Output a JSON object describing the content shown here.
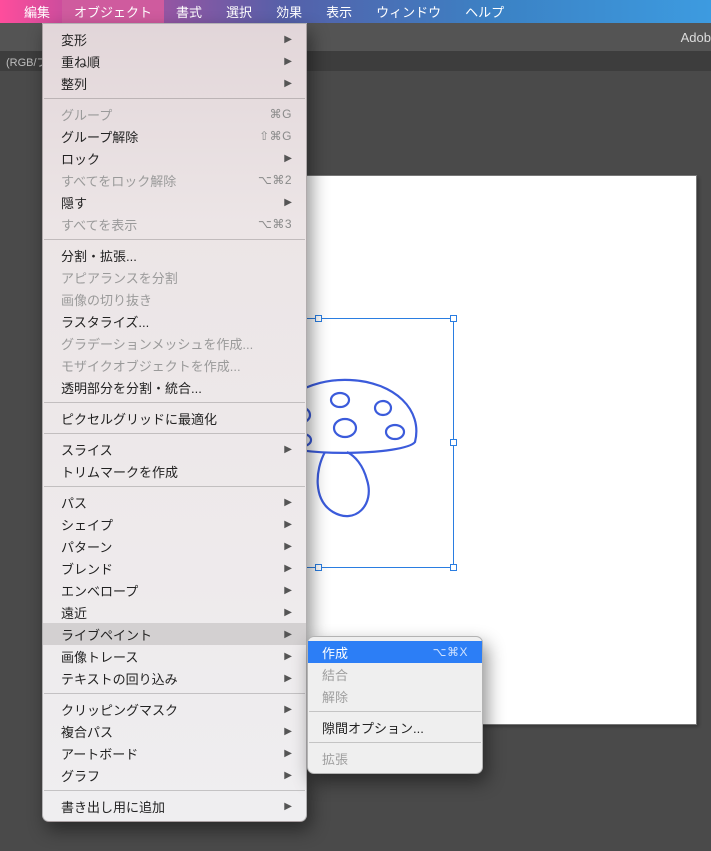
{
  "menubar": {
    "items": [
      "編集",
      "オブジェクト",
      "書式",
      "選択",
      "効果",
      "表示",
      "ウィンドウ",
      "ヘルプ"
    ],
    "active_index": 1
  },
  "topband": {
    "app_label": "Adob"
  },
  "docband": {
    "label": "(RGB/プ"
  },
  "dropdown": {
    "groups": [
      [
        {
          "label": "変形",
          "arrow": true
        },
        {
          "label": "重ね順",
          "arrow": true
        },
        {
          "label": "整列",
          "arrow": true
        }
      ],
      [
        {
          "label": "グループ",
          "shortcut": "⌘G",
          "disabled": true
        },
        {
          "label": "グループ解除",
          "shortcut": "⇧⌘G"
        },
        {
          "label": "ロック",
          "arrow": true
        },
        {
          "label": "すべてをロック解除",
          "shortcut": "⌥⌘2",
          "disabled": true
        },
        {
          "label": "隠す",
          "arrow": true
        },
        {
          "label": "すべてを表示",
          "shortcut": "⌥⌘3",
          "disabled": true
        }
      ],
      [
        {
          "label": "分割・拡張..."
        },
        {
          "label": "アピアランスを分割",
          "disabled": true
        },
        {
          "label": "画像の切り抜き",
          "disabled": true
        },
        {
          "label": "ラスタライズ..."
        },
        {
          "label": "グラデーションメッシュを作成...",
          "disabled": true
        },
        {
          "label": "モザイクオブジェクトを作成...",
          "disabled": true
        },
        {
          "label": "透明部分を分割・統合..."
        }
      ],
      [
        {
          "label": "ピクセルグリッドに最適化"
        }
      ],
      [
        {
          "label": "スライス",
          "arrow": true
        },
        {
          "label": "トリムマークを作成"
        }
      ],
      [
        {
          "label": "パス",
          "arrow": true
        },
        {
          "label": "シェイプ",
          "arrow": true
        },
        {
          "label": "パターン",
          "arrow": true
        },
        {
          "label": "ブレンド",
          "arrow": true
        },
        {
          "label": "エンベロープ",
          "arrow": true
        },
        {
          "label": "遠近",
          "arrow": true
        },
        {
          "label": "ライブペイント",
          "arrow": true,
          "highlight": true
        },
        {
          "label": "画像トレース",
          "arrow": true
        },
        {
          "label": "テキストの回り込み",
          "arrow": true
        }
      ],
      [
        {
          "label": "クリッピングマスク",
          "arrow": true
        },
        {
          "label": "複合パス",
          "arrow": true
        },
        {
          "label": "アートボード",
          "arrow": true
        },
        {
          "label": "グラフ",
          "arrow": true
        }
      ],
      [
        {
          "label": "書き出し用に追加",
          "arrow": true
        }
      ]
    ]
  },
  "submenu": {
    "groups": [
      [
        {
          "label": "作成",
          "shortcut": "⌥⌘X",
          "selected": true
        },
        {
          "label": "結合",
          "disabled": true
        },
        {
          "label": "解除",
          "disabled": true
        }
      ],
      [
        {
          "label": "隙間オプション..."
        }
      ],
      [
        {
          "label": "拡張",
          "disabled": true
        }
      ]
    ]
  }
}
